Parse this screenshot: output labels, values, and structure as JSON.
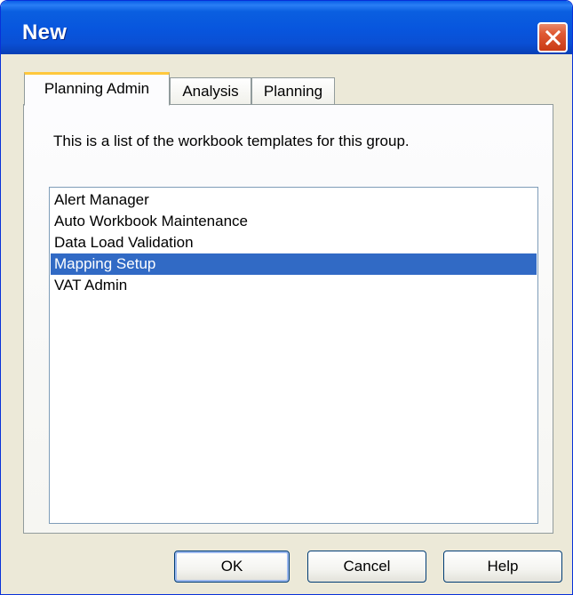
{
  "window": {
    "title": "New",
    "close_icon": "close-icon"
  },
  "tabs": [
    {
      "label": "Planning Admin",
      "active": true
    },
    {
      "label": "Analysis",
      "active": false
    },
    {
      "label": "Planning",
      "active": false
    }
  ],
  "panel": {
    "description": "This is a list of the workbook templates for this group.",
    "templates": [
      {
        "label": "Alert Manager",
        "selected": false
      },
      {
        "label": "Auto Workbook Maintenance",
        "selected": false
      },
      {
        "label": "Data Load Validation",
        "selected": false
      },
      {
        "label": "Mapping Setup",
        "selected": true
      },
      {
        "label": "VAT Admin",
        "selected": false
      }
    ]
  },
  "buttons": {
    "ok": "OK",
    "cancel": "Cancel",
    "help": "Help"
  },
  "colors": {
    "selection": "#316ac5",
    "titlebar": "#0855dd",
    "active_tab_accent": "#ffc83c"
  }
}
